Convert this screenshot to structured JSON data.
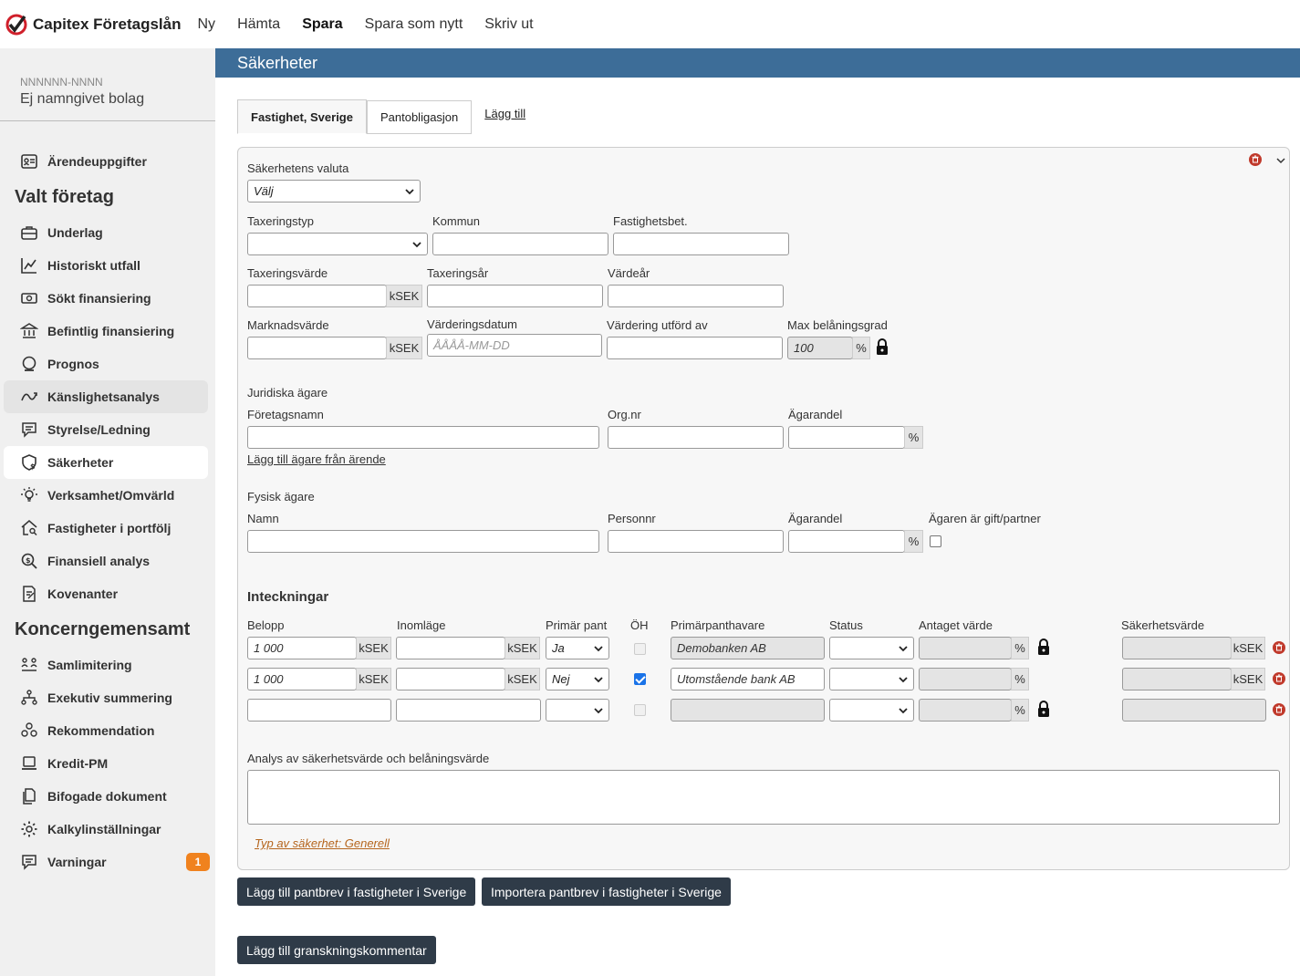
{
  "app": {
    "title": "Capitex Företagslån"
  },
  "topnav": [
    {
      "label": "Ny",
      "bold": false
    },
    {
      "label": "Hämta",
      "bold": false
    },
    {
      "label": "Spara",
      "bold": true
    },
    {
      "label": "Spara som nytt",
      "bold": false
    },
    {
      "label": "Skriv ut",
      "bold": false
    }
  ],
  "company": {
    "id": "NNNNNN-NNNN",
    "name": "Ej namngivet bolag"
  },
  "sidebar": {
    "item_arende": "Ärendeuppgifter",
    "heading_valt": "Valt företag",
    "items_valt": [
      "Underlag",
      "Historiskt utfall",
      "Sökt finansiering",
      "Befintlig finansiering",
      "Prognos",
      "Känslighetsanalys",
      "Styrelse/Ledning",
      "Säkerheter",
      "Verksamhet/Omvärld",
      "Fastigheter i portfölj",
      "Finansiell analys",
      "Kovenanter"
    ],
    "heading_koncern": "Koncerngemensamt",
    "items_koncern": [
      "Samlimitering",
      "Exekutiv summering",
      "Rekommendation",
      "Kredit-PM",
      "Bifogade dokument",
      "Kalkylinställningar",
      "Varningar"
    ],
    "warnings_count": "1"
  },
  "section": {
    "title": "Säkerheter"
  },
  "tabs": {
    "tab1": "Fastighet, Sverige",
    "tab2": "Pantobligasjon",
    "add": "Lägg till"
  },
  "form": {
    "valuta_label": "Säkerhetens valuta",
    "valuta_value": "Välj",
    "taxeringstyp_label": "Taxeringstyp",
    "kommun_label": "Kommun",
    "fastighetsbet_label": "Fastighetsbet.",
    "taxeringsvarde_label": "Taxeringsvärde",
    "taxeringsar_label": "Taxeringsår",
    "vardear_label": "Värdeår",
    "marknadsvarde_label": "Marknadsvärde",
    "varderingsdatum_label": "Värderingsdatum",
    "varderingsdatum_placeholder": "ÅÅÅÅ-MM-DD",
    "vardering_utford_label": "Värdering utförd av",
    "max_belaning_label": "Max belåningsgrad",
    "max_belaning_value": "100",
    "unit_ksek": "kSEK",
    "unit_pct": "%",
    "juridiska_label": "Juridiska ägare",
    "foretagsnamn_label": "Företagsnamn",
    "orgnr_label": "Org.nr",
    "agarandel_label": "Ägarandel",
    "add_owner_link": "Lägg till ägare från ärende",
    "fysisk_label": "Fysisk ägare",
    "namn_label": "Namn",
    "personnr_label": "Personnr",
    "gift_label": "Ägaren är gift/partner",
    "inteckningar_label": "Inteckningar",
    "col_belopp": "Belopp",
    "col_inomlage": "Inomläge",
    "col_primar": "Primär pant",
    "col_oh": "ÖH",
    "col_primarpanthavare": "Primärpanthavare",
    "col_status": "Status",
    "col_antaget": "Antaget värde",
    "col_sakerhetsvarde": "Säkerhetsvärde",
    "rows": [
      {
        "belopp": "1 000",
        "primar": "Ja",
        "holder": "Demobanken AB"
      },
      {
        "belopp": "1 000",
        "primar": "Nej",
        "holder": "Utomstående bank AB"
      },
      {
        "belopp": "",
        "primar": "",
        "holder": ""
      }
    ],
    "analys_label": "Analys av säkerhetsvärde och belåningsvärde",
    "typ_link": "Typ av säkerhet: Generell"
  },
  "buttons": {
    "add_pantbrev": "Lägg till pantbrev i fastigheter i Sverige",
    "import_pantbrev": "Importera pantbrev i fastigheter i Sverige",
    "add_comment": "Lägg till granskningskommentar"
  },
  "colors": {
    "header_bg": "#3d6d98",
    "button_bg": "#2f3b48",
    "badge": "#f0821e",
    "trash": "#c0392b",
    "link_orange": "#b5651d"
  }
}
